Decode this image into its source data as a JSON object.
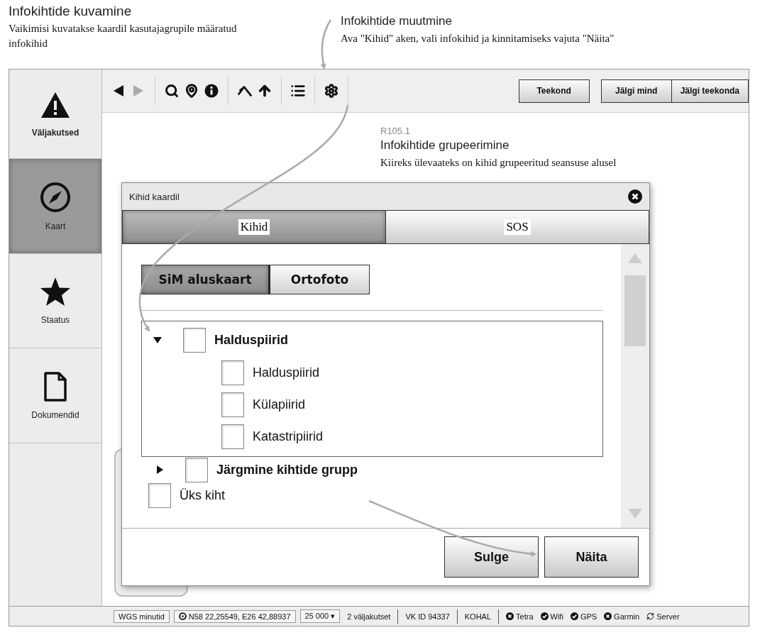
{
  "notes": {
    "display": {
      "title": "Infokihtide kuvamine",
      "text": "Vaikimisi kuvatakse kaardil kasutajagrupile määratud infokihid"
    },
    "change": {
      "title": "Infokihtide muutmine",
      "text": "Ava \"Kihid\" aken, vali infokihid ja kinnitamiseks vajuta \"Näita\""
    },
    "grouping": {
      "code": "R105.1",
      "title": "Infokihtide grupeerimine",
      "text": "Kiireks ülevaateks on kihid grupeeritud seansuse alusel"
    }
  },
  "sidebar": {
    "items": [
      {
        "kind": "warning",
        "label": "Väljakutsed",
        "selected": false,
        "emphasized": true
      },
      {
        "kind": "compass",
        "label": "Kaart",
        "selected": true,
        "emphasized": false
      },
      {
        "kind": "star",
        "label": "Staatus",
        "selected": false,
        "emphasized": false
      },
      {
        "kind": "document",
        "label": "Dokumendid",
        "selected": false,
        "emphasized": false
      }
    ]
  },
  "toolbar": {
    "tool_groups": [
      {
        "tools": [
          {
            "kind": "back",
            "disabled": false
          },
          {
            "kind": "forward",
            "disabled": true
          }
        ]
      },
      {
        "tools": [
          {
            "kind": "search",
            "disabled": false
          },
          {
            "kind": "pin",
            "disabled": false
          },
          {
            "kind": "info",
            "disabled": false
          }
        ]
      },
      {
        "tools": [
          {
            "kind": "peak",
            "disabled": false
          },
          {
            "kind": "up",
            "disabled": false
          }
        ]
      },
      {
        "tools": [
          {
            "kind": "list",
            "disabled": false
          }
        ]
      },
      {
        "tools": [
          {
            "kind": "settings",
            "disabled": false
          }
        ]
      }
    ],
    "buttons": [
      {
        "labels": [
          "Teekond"
        ]
      },
      {
        "labels": [
          "Jälgi mind",
          "Jälgi teekonda"
        ]
      }
    ]
  },
  "dialog": {
    "title": "Kihid kaardil",
    "tabs": [
      {
        "label": "Kihid",
        "selected": true
      },
      {
        "label": "SOS",
        "selected": false
      }
    ],
    "basemaps": [
      {
        "label": "SiM aluskaart",
        "selected": true
      },
      {
        "label": "Ortofoto",
        "selected": false
      }
    ],
    "layers": [
      {
        "kind": "group",
        "label": "Halduspiirid",
        "checked": false,
        "expanded": true,
        "children": [
          {
            "kind": "layer",
            "label": "Halduspiirid",
            "checked": false
          },
          {
            "kind": "layer",
            "label": "Külapiirid",
            "checked": false
          },
          {
            "kind": "layer",
            "label": "Katastripiirid",
            "checked": false
          }
        ]
      },
      {
        "kind": "group",
        "label": "Järgmine kihtide grupp",
        "checked": false,
        "expanded": false
      },
      {
        "kind": "layer",
        "label": "Üks kiht",
        "checked": false
      }
    ],
    "buttons": [
      "Sulge",
      "Näita"
    ]
  },
  "status_bar": {
    "coordinate_system": "WGS minutid",
    "coordinates": "N58 22,25549, E26 42,88937",
    "scale": "25 000 ▾",
    "calls": "2 väljakutset",
    "vehicle": "VK ID 94337",
    "state": "KOHAL",
    "connections": [
      {
        "label": "Tetra",
        "kind": "error"
      },
      {
        "label": "Wifi",
        "kind": "ok"
      },
      {
        "label": "GPS",
        "kind": "ok"
      },
      {
        "label": "Garmin",
        "kind": "error"
      },
      {
        "label": "Server",
        "kind": "sync"
      }
    ]
  }
}
